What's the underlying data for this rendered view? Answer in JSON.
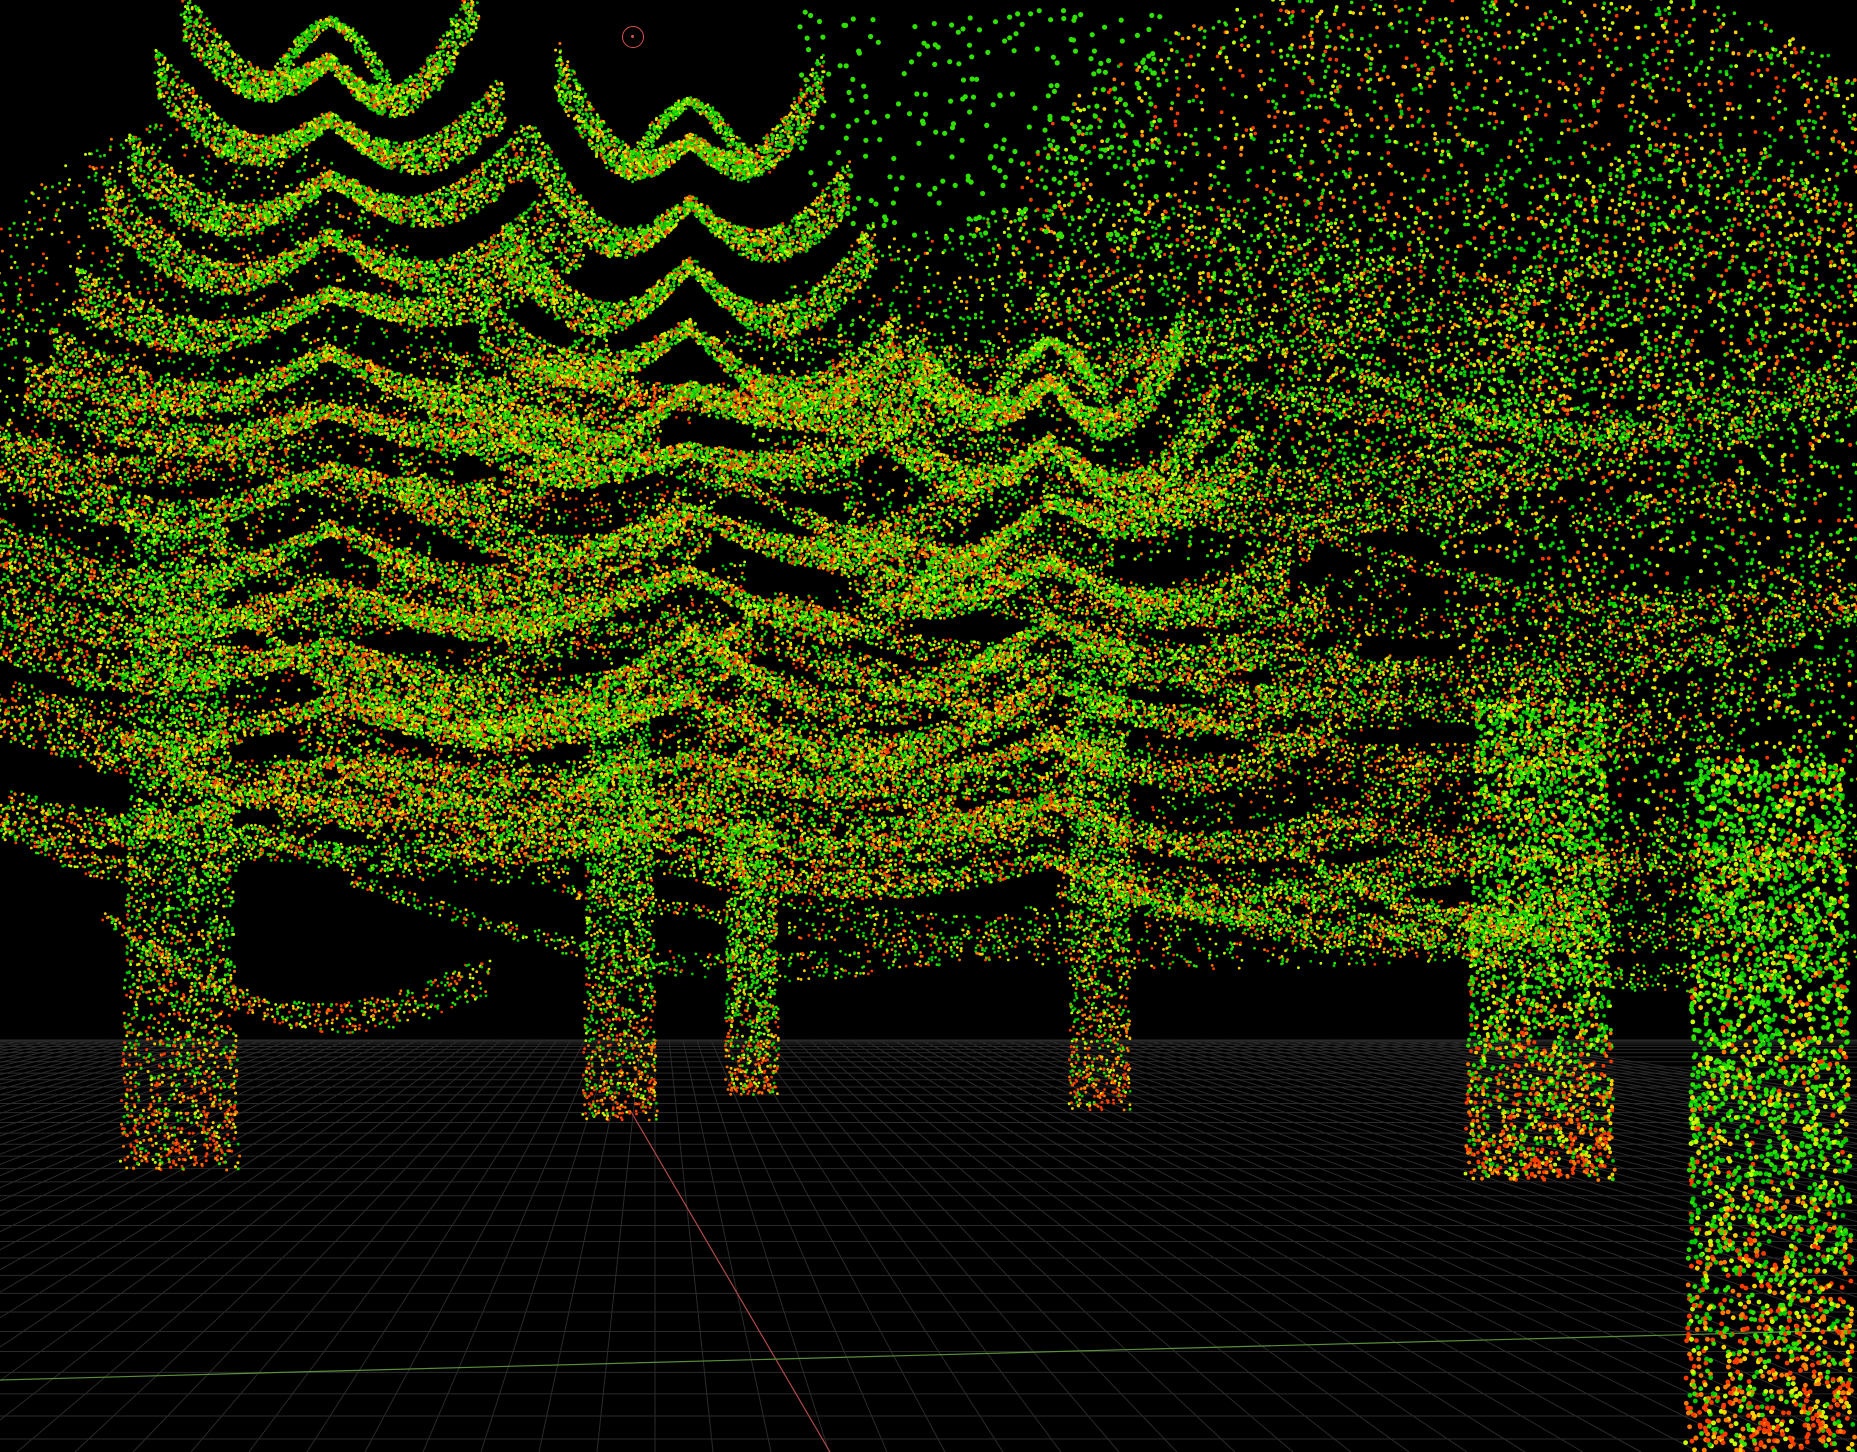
{
  "viewport": {
    "background": "#000000",
    "grid_color": "#2b2b2b",
    "axis_x_color": "#b04a4a",
    "axis_y_color": "#5a8f3a",
    "colormap": [
      "#ff3c00",
      "#ff7a00",
      "#ffd000",
      "#c8ff00",
      "#2fe000",
      "#00c800"
    ],
    "pivot_marker_color": "#d9534f",
    "pivot_icon": "orbit-pivot-icon",
    "trees": [
      {
        "id": "tree-left",
        "kind": "conifer"
      },
      {
        "id": "tree-center",
        "kind": "conifer"
      },
      {
        "id": "tree-center-back",
        "kind": "conifer"
      },
      {
        "id": "tree-right-mid",
        "kind": "conifer"
      },
      {
        "id": "tree-right",
        "kind": "broadleaf"
      },
      {
        "id": "tree-foreground-right",
        "kind": "broadleaf"
      }
    ]
  }
}
